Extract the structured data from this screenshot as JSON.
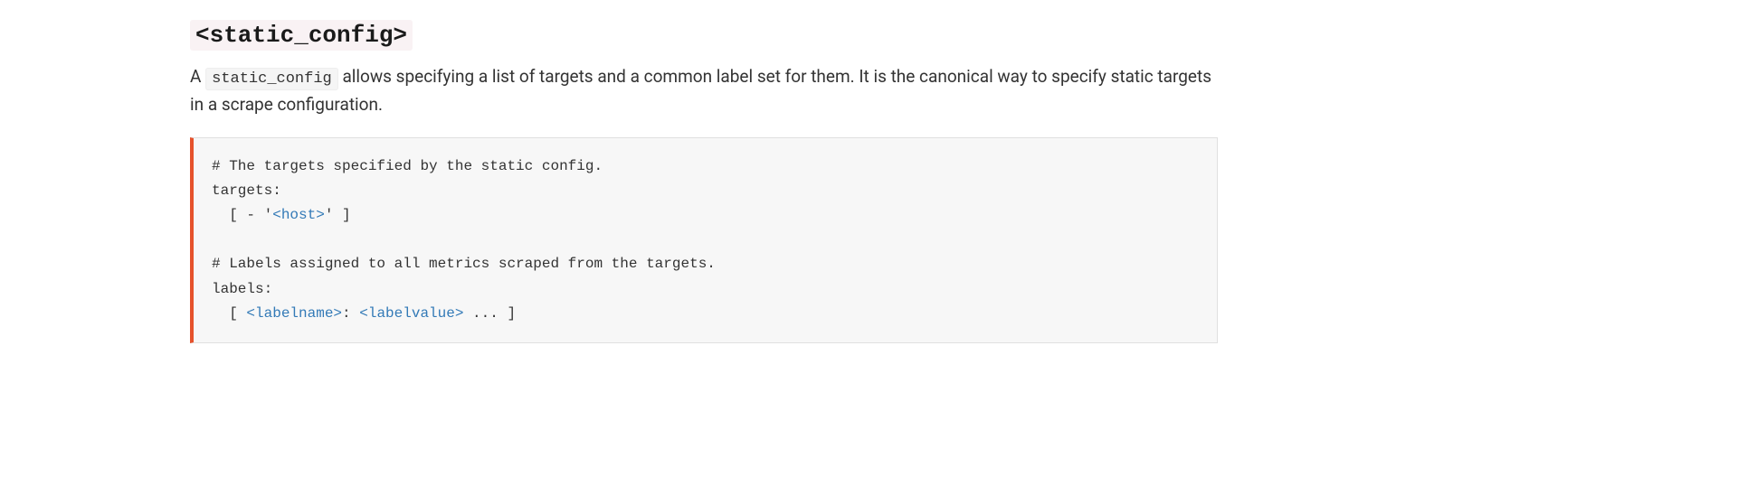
{
  "heading": {
    "code": "<static_config>"
  },
  "description": {
    "prefix": "A ",
    "code": "static_config",
    "suffix": " allows specifying a list of targets and a common label set for them. It is the canonical way to specify static targets in a scrape configuration."
  },
  "code": {
    "line1": "# The targets specified by the static config.",
    "line2": "targets:",
    "line3_prefix": "  [ - '",
    "line3_link": "<host>",
    "line3_suffix": "' ]",
    "line4": "",
    "line5": "# Labels assigned to all metrics scraped from the targets.",
    "line6": "labels:",
    "line7_prefix": "  [ ",
    "line7_link1": "<labelname>",
    "line7_mid": ": ",
    "line7_link2": "<labelvalue>",
    "line7_suffix": " ... ]"
  }
}
